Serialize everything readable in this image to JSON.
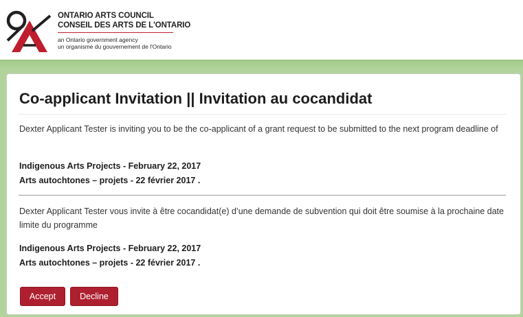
{
  "header": {
    "org_name_en": "ONTARIO ARTS COUNCIL",
    "org_name_fr": "CONSEIL DES ARTS DE L'ONTARIO",
    "agency_en": "an Ontario government agency",
    "agency_fr": "un organisme du gouvernement de l'Ontario",
    "logo_icon": "oac-logo-icon",
    "brand_color": "#bf1e2e"
  },
  "page": {
    "title": "Co-applicant Invitation || Invitation au cocandidat"
  },
  "invitation_en": {
    "message": "Dexter Applicant Tester is inviting you to be the co-applicant of a grant request to be submitted to the next program deadline of",
    "program_en": "Indigenous Arts Projects - February 22, 2017",
    "program_fr": "Arts autochtones – projets - 22 février 2017 ."
  },
  "invitation_fr": {
    "message": "Dexter Applicant Tester vous invite à être cocandidat(e) d’une demande de subvention qui doit être soumise à la prochaine date limite du programme",
    "program_en": "Indigenous Arts Projects - February 22, 2017",
    "program_fr": "Arts autochtones – projets - 22 février 2017 ."
  },
  "actions": {
    "accept_label": "Accept",
    "decline_label": "Decline",
    "button_color": "#ae2030"
  },
  "theme": {
    "band_color": "#b2d49c"
  }
}
